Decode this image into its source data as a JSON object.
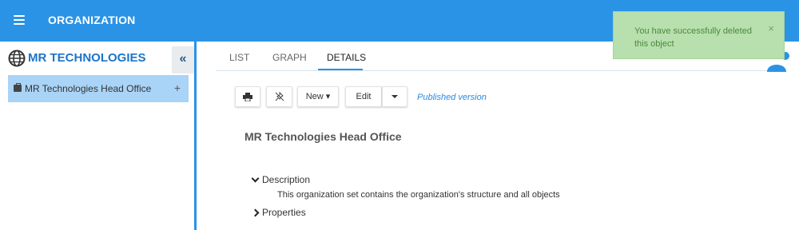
{
  "header": {
    "title": "ORGANIZATION",
    "menu_icon": "hamburger-icon"
  },
  "sidebar": {
    "org_name": "MR TECHNOLOGIES",
    "org_icon": "globe-icon",
    "collapse_label": "«",
    "items": [
      {
        "label": "MR Technologies Head Office",
        "icon": "briefcase-icon",
        "action": "+"
      }
    ]
  },
  "tabs": [
    {
      "label": "LIST"
    },
    {
      "label": "GRAPH"
    },
    {
      "label": "DETAILS",
      "active": true
    }
  ],
  "toolbar": {
    "new_label": "New ▾",
    "edit_label": "Edit",
    "status": "Published version"
  },
  "detail": {
    "title": "MR Technologies Head Office",
    "description_label": "Description",
    "description_text": "This organization set contains the organization's structure and all objects",
    "properties_label": "Properties"
  },
  "toast": {
    "message": "You have successfully deleted this object",
    "close": "×"
  },
  "colors": {
    "primary": "#2a93e6",
    "selected_row": "#a9d4f7",
    "toast_bg": "#b8dfae",
    "toast_text": "#4a8a3c",
    "link": "#2a8ae0"
  }
}
